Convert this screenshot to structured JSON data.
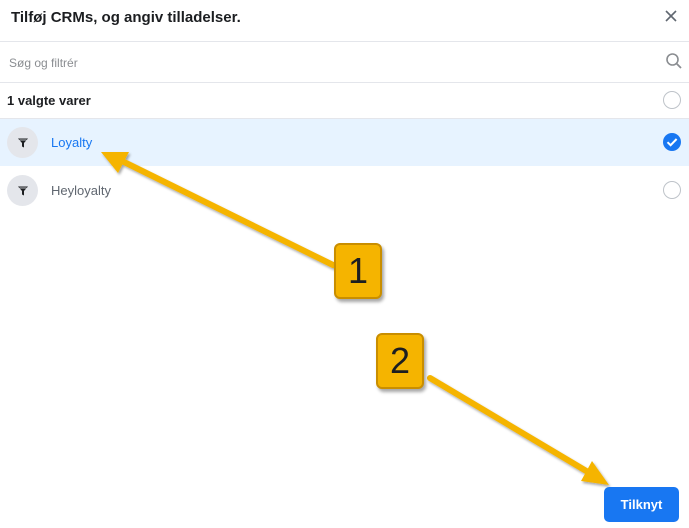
{
  "dialog": {
    "title": "Tilføj CRMs, og angiv tilladelser.",
    "search_placeholder": "Søg og filtrér",
    "selected_count_label": "1 valgte varer",
    "items": [
      {
        "label": "Loyalty",
        "selected": true
      },
      {
        "label": "Heyloyalty",
        "selected": false
      }
    ],
    "connect_button": "Tilknyt"
  },
  "annotations": [
    {
      "label": "1"
    },
    {
      "label": "2"
    }
  ],
  "colors": {
    "accent": "#1877f2",
    "selected_row_bg": "#e7f3ff",
    "annotation": "#f5b400"
  }
}
